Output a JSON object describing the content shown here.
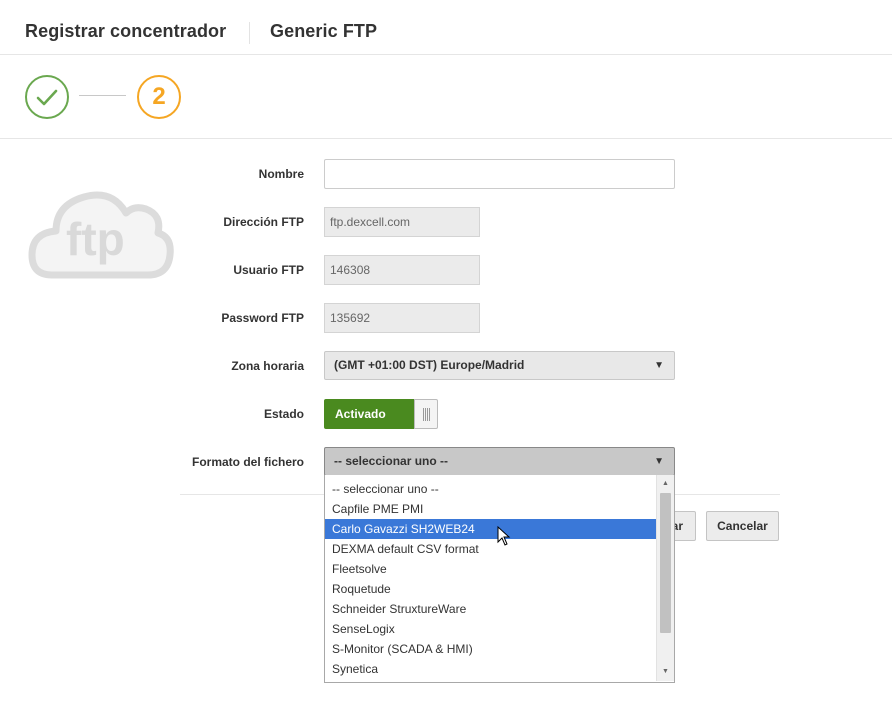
{
  "header": {
    "title": "Registrar concentrador",
    "subtitle": "Generic FTP"
  },
  "stepper": {
    "step1_state": "completed",
    "step2_number": "2",
    "colors": {
      "done": "#6aa84f",
      "active": "#f5a623"
    }
  },
  "logo": {
    "text": "ftp"
  },
  "form": {
    "nombre": {
      "label": "Nombre",
      "value": "",
      "placeholder": ""
    },
    "direccion": {
      "label": "Dirección FTP",
      "value": "ftp.dexcell.com"
    },
    "usuario": {
      "label": "Usuario FTP",
      "value": "146308"
    },
    "password": {
      "label": "Password FTP",
      "value": "135692"
    },
    "zona": {
      "label": "Zona horaria",
      "value": "(GMT +01:00 DST) Europe/Madrid"
    },
    "estado": {
      "label": "Estado",
      "value": "Activado",
      "color": "#4a8a1f"
    },
    "formato": {
      "label": "Formato del fichero",
      "value": "-- seleccionar uno --",
      "options": [
        "-- seleccionar uno --",
        "Capfile PME PMI",
        "Carlo Gavazzi SH2WEB24",
        "DEXMA default CSV format",
        "Fleetsolve",
        "Roquetude",
        "Schneider StruxtureWare",
        "SenseLogix",
        "S-Monitor (SCADA & HMI)",
        "Synetica"
      ],
      "highlighted": "Carlo Gavazzi SH2WEB24"
    }
  },
  "buttons": {
    "save_visible_fragment": "ar",
    "cancel": "Cancelar"
  },
  "colors": {
    "highlight": "#3a78d8"
  }
}
